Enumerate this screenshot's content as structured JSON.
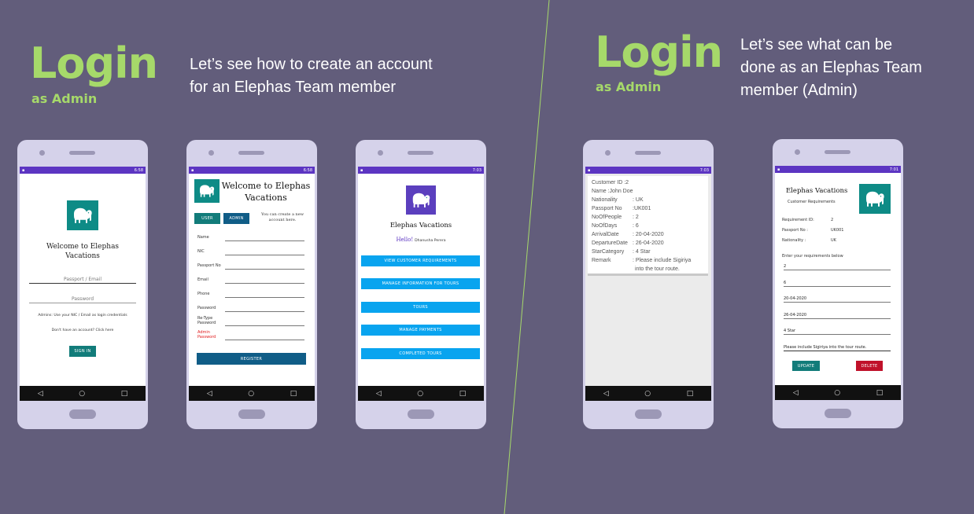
{
  "left_panel": {
    "title": "Login",
    "subtitle": "as Admin",
    "desc_line1": "Let’s see how to create an account",
    "desc_line2": "for an Elephas Team member"
  },
  "right_panel": {
    "title": "Login",
    "subtitle": "as Admin",
    "desc_line1": "Let’s see what can be",
    "desc_line2": "done as an Elephas Team",
    "desc_line3": "member (Admin)"
  },
  "colors": {
    "accent": "#a6d96a",
    "background": "#625d7b",
    "teal": "#127c7a",
    "purple": "#5c35c2",
    "blue": "#09a4ef",
    "red": "#c0112a"
  },
  "nav": {
    "back": "◁",
    "home": "○",
    "recent": "□"
  },
  "phone1": {
    "time": "6:58",
    "welcome_line1": "Welcome to Elephas",
    "welcome_line2": "Vacations",
    "passport_placeholder": "Passport / Email",
    "password_placeholder": "Password",
    "admin_hint": "Admins: Use your NIC / Email as login credentials",
    "signup_hint": "Don't have an account? Click here",
    "sign_in": "SIGN IN"
  },
  "phone2": {
    "time": "6:58",
    "welcome_line1": "Welcome to Elephas",
    "welcome_line2": "Vacations",
    "tab_user": "USER",
    "tab_admin": "ADMIN",
    "note_line1": "You can create a new",
    "note_line2": "account here.",
    "labels": {
      "name": "Name",
      "nic": "NIC",
      "passport": "Passport No",
      "email": "Email",
      "phone": "Phone",
      "password": "Password",
      "retype_1": "Re-Type",
      "retype_2": "Password",
      "admin_1": "Admin",
      "admin_2": "Password"
    },
    "register": "REGISTER"
  },
  "phone3": {
    "time": "7:03",
    "title": "Elephas Vacations",
    "hello": "Hello!",
    "user_name": "Dhanusha Perera",
    "buttons": [
      "VIEW CUSTOMER REQUIREMENTS",
      "MANAGE INFORMATION FOR TOURS",
      "TOURS",
      "MANAGE PAYMENTS",
      "COMPLETED TOURS"
    ]
  },
  "phone4": {
    "time": "7:03",
    "rows": [
      {
        "label": "Customer ID :2",
        "value": ""
      },
      {
        "label": "Name :John Doe",
        "value": ""
      },
      {
        "label": "Nationality",
        "value": ": UK"
      },
      {
        "label": "Passport No",
        "value": ":UK001"
      },
      {
        "label": "NoOfPeople",
        "value": ": 2"
      },
      {
        "label": "NoOfDays",
        "value": ": 6"
      },
      {
        "label": "ArrivalDate",
        "value": ": 20-04-2020"
      },
      {
        "label": "DepartureDate",
        "value": ": 26-04-2020"
      },
      {
        "label": "StarCategory",
        "value": ": 4 Star"
      },
      {
        "label": "Remark",
        "value": ": Please include Sigiriya"
      },
      {
        "label": "",
        "value": "into the tour route."
      }
    ]
  },
  "phone5": {
    "time": "7:01",
    "title": "Elephas Vacations",
    "subtitle": "Customer Requirements",
    "req_id_label": "Requirement ID:",
    "req_id": "2",
    "passport_label": "Passport No :",
    "passport": "UK001",
    "nationality_label": "Nationality :",
    "nationality": "UK",
    "prompt": "Enter your requirements below",
    "fields": [
      "2",
      "6",
      "20-04-2020",
      "26-04-2020",
      "4 Star",
      "Please include Sigiriya into the tour route."
    ],
    "update": "UPDATE",
    "delete": "DELETE"
  }
}
